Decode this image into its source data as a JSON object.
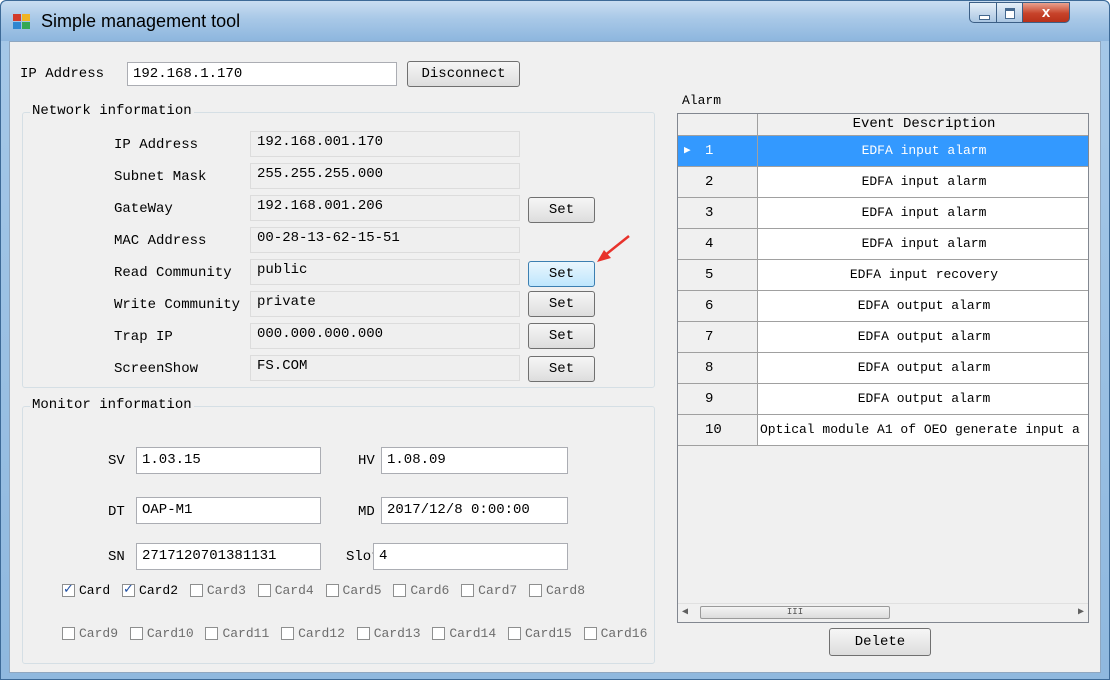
{
  "window": {
    "title": "Simple management tool",
    "close_glyph": "x"
  },
  "connection": {
    "ip_label": "IP Address",
    "ip_value": "192.168.1.170",
    "disconnect_label": "Disconnect"
  },
  "network": {
    "group_title": "Network information",
    "ip_address": {
      "label": "IP Address",
      "value": "192.168.001.170"
    },
    "subnet_mask": {
      "label": "Subnet Mask",
      "value": "255.255.255.000"
    },
    "gateway": {
      "label": "GateWay",
      "value": "192.168.001.206",
      "button": "Set"
    },
    "mac_address": {
      "label": "MAC Address",
      "value": "00-28-13-62-15-51"
    },
    "read_community": {
      "label": "Read Community",
      "value": "public",
      "button": "Set"
    },
    "write_community": {
      "label": "Write Community",
      "value": "private",
      "button": "Set"
    },
    "trap_ip": {
      "label": "Trap IP",
      "value": "000.000.000.000",
      "button": "Set"
    },
    "screen_show": {
      "label": "ScreenShow",
      "value": "FS.COM",
      "button": "Set"
    }
  },
  "monitor": {
    "group_title": "Monitor information",
    "sv": {
      "label": "SV",
      "value": "1.03.15"
    },
    "hv": {
      "label": "HV",
      "value": "1.08.09"
    },
    "dt": {
      "label": "DT",
      "value": "OAP-M1"
    },
    "md": {
      "label": "MD",
      "value": "2017/12/8 0:00:00"
    },
    "sn": {
      "label": "SN",
      "value": "2717120701381131"
    },
    "slot": {
      "label": "Slot",
      "value": "4"
    },
    "cards": [
      {
        "label": "Card",
        "checked": true
      },
      {
        "label": "Card2",
        "checked": true
      },
      {
        "label": "Card3",
        "checked": false
      },
      {
        "label": "Card4",
        "checked": false
      },
      {
        "label": "Card5",
        "checked": false
      },
      {
        "label": "Card6",
        "checked": false
      },
      {
        "label": "Card7",
        "checked": false
      },
      {
        "label": "Card8",
        "checked": false
      },
      {
        "label": "Card9",
        "checked": false
      },
      {
        "label": "Card10",
        "checked": false
      },
      {
        "label": "Card11",
        "checked": false
      },
      {
        "label": "Card12",
        "checked": false
      },
      {
        "label": "Card13",
        "checked": false
      },
      {
        "label": "Card14",
        "checked": false
      },
      {
        "label": "Card15",
        "checked": false
      },
      {
        "label": "Card16",
        "checked": false
      }
    ]
  },
  "alarm": {
    "title": "Alarm",
    "column_header": "Event Description",
    "scroll_thumb_glyph": "III",
    "rows": [
      {
        "index": "1",
        "description": "EDFA input alarm",
        "selected": true
      },
      {
        "index": "2",
        "description": "EDFA input alarm"
      },
      {
        "index": "3",
        "description": "EDFA input alarm"
      },
      {
        "index": "4",
        "description": "EDFA input alarm"
      },
      {
        "index": "5",
        "description": "EDFA input recovery"
      },
      {
        "index": "6",
        "description": "EDFA output alarm"
      },
      {
        "index": "7",
        "description": "EDFA output alarm"
      },
      {
        "index": "8",
        "description": "EDFA output alarm"
      },
      {
        "index": "9",
        "description": "EDFA output alarm"
      },
      {
        "index": "10",
        "description": "Optical module A1 of OEO generate input a"
      }
    ],
    "delete_label": "Delete"
  },
  "colors": {
    "selection": "#3399ff",
    "annotation_arrow": "#e8322b",
    "title_bar": "#a8c8e7"
  }
}
